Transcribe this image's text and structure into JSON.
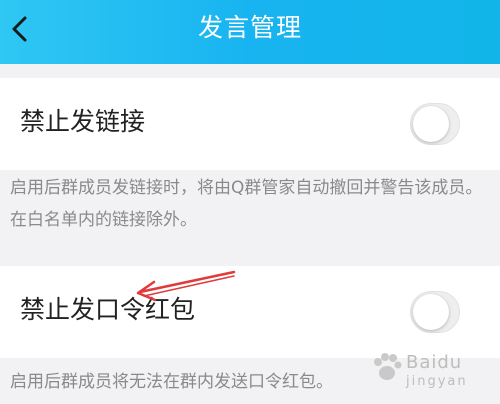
{
  "header": {
    "title": "发言管理",
    "back_icon": "chevron-left-icon"
  },
  "settings": [
    {
      "label": "禁止发链接",
      "enabled": false,
      "description": "启用后群成员发链接时，将由Q群管家自动撤回并警告该成员。在白名单内的链接除外。"
    },
    {
      "label": "禁止发口令红包",
      "enabled": false,
      "description": "启用后群成员将无法在群内发送口令红包。"
    }
  ],
  "annotation": {
    "arrow_color": "#e03a3a"
  },
  "watermark": {
    "brand": "Baidu",
    "sub": "jingyan"
  }
}
